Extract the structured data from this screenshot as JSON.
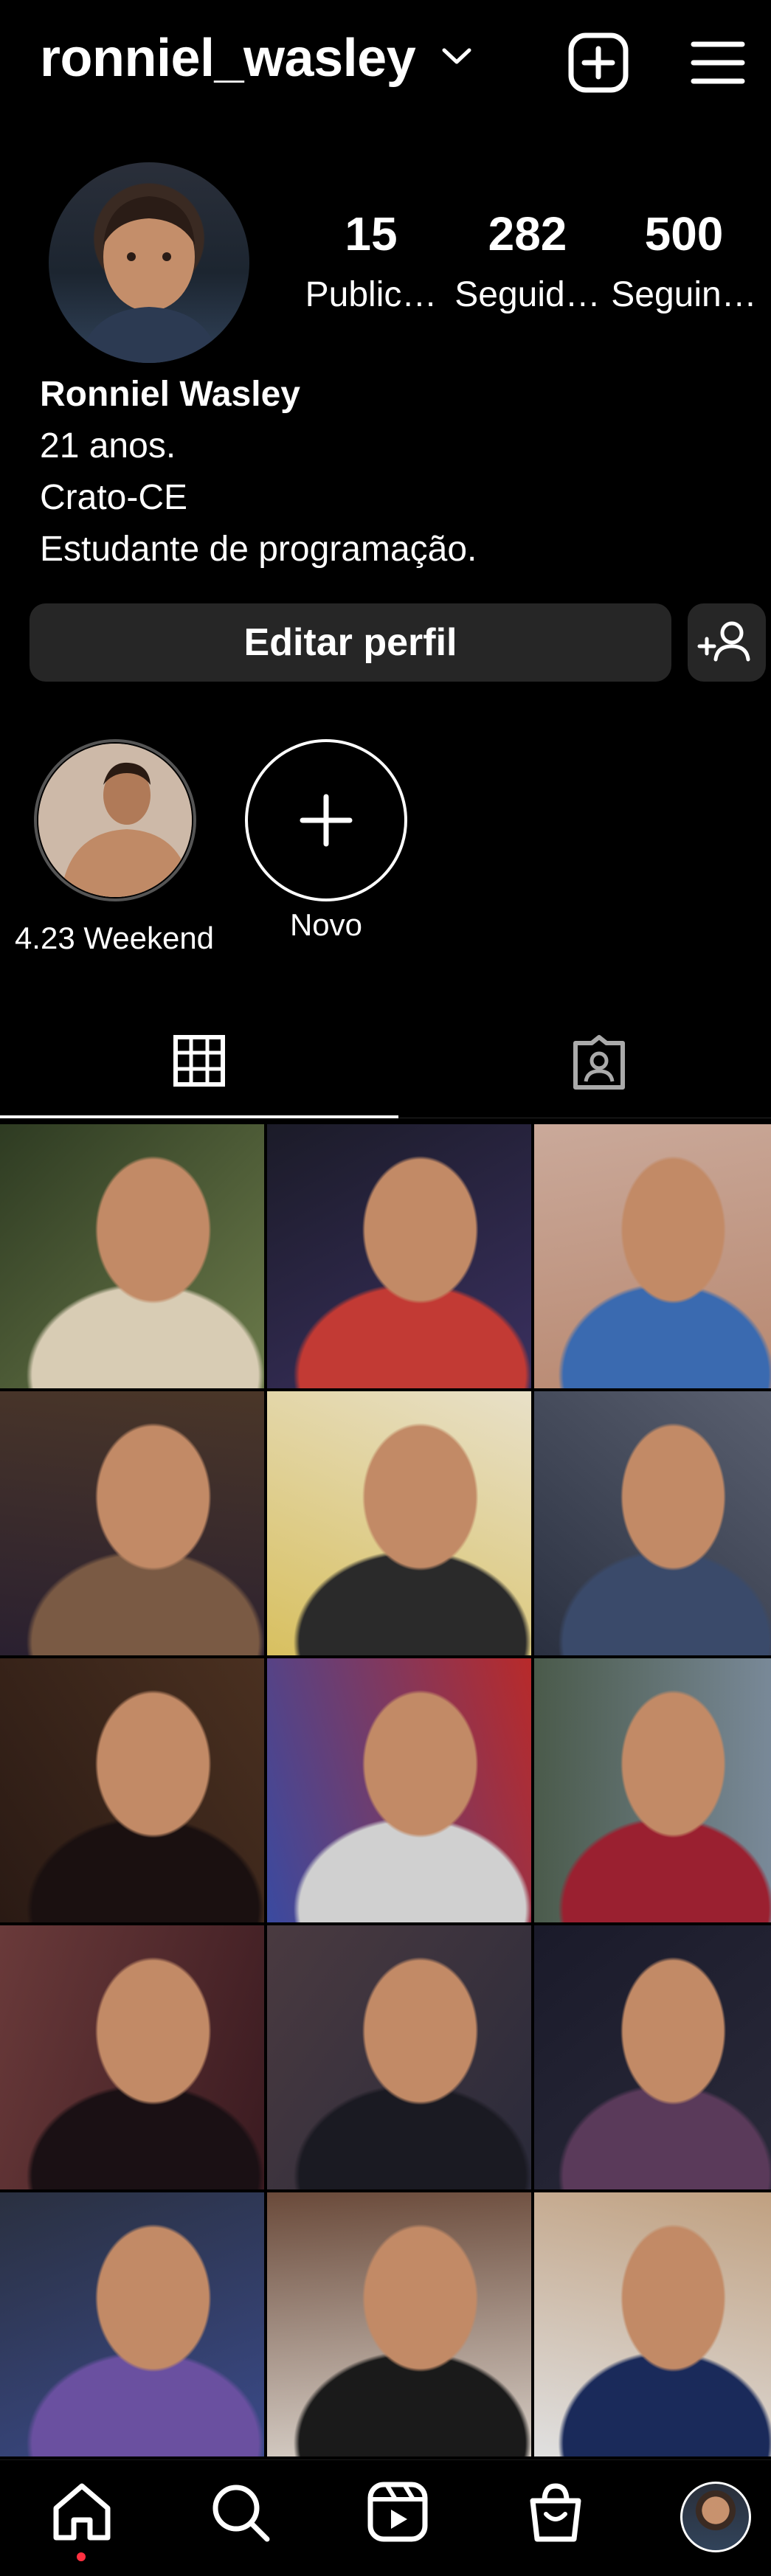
{
  "header": {
    "username": "ronniel_wasley",
    "icons": [
      "chevron-down-icon",
      "new-post-icon",
      "menu-icon"
    ]
  },
  "stats": [
    {
      "value": "15",
      "label": "Public…"
    },
    {
      "value": "282",
      "label": "Seguid…"
    },
    {
      "value": "500",
      "label": "Seguin…"
    }
  ],
  "bio": {
    "name": "Ronniel Wasley",
    "line1": "21 anos.",
    "line2": "Crato-CE",
    "line3": "Estudante de programação."
  },
  "actions": {
    "edit_profile": "Editar perfil",
    "add_person_icon": "add-person-icon"
  },
  "highlights": [
    {
      "label": "4.23 Weekend"
    },
    {
      "label": "Novo"
    }
  ],
  "tabs": [
    {
      "icon": "grid-icon",
      "active": true
    },
    {
      "icon": "tagged-icon",
      "active": false
    }
  ],
  "grid_tiles": [
    {
      "colors": [
        "#2e3b22",
        "#6b7a4a",
        "#d8ccb4"
      ]
    },
    {
      "colors": [
        "#1b1b28",
        "#3a3060",
        "#c23a34"
      ]
    },
    {
      "colors": [
        "#caa99a",
        "#b88870",
        "#3a6ab0"
      ]
    },
    {
      "colors": [
        "#4a3628",
        "#2a2030",
        "#7a5a44"
      ]
    },
    {
      "colors": [
        "#e8e0c8",
        "#d8c060",
        "#2a2a2a"
      ]
    },
    {
      "colors": [
        "#5a6070",
        "#2a3040",
        "#3a4a6a"
      ]
    },
    {
      "colors": [
        "#4a3020",
        "#2a1a14",
        "#1a1010"
      ]
    },
    {
      "colors": [
        "#b82a2a",
        "#3a4aa0",
        "#d0d0d0"
      ]
    },
    {
      "colors": [
        "#7a8a9a",
        "#4a5a4a",
        "#9a2030"
      ]
    },
    {
      "colors": [
        "#3a1a20",
        "#6a3a3a",
        "#1a1014"
      ]
    },
    {
      "colors": [
        "#2a2a3a",
        "#4a3a40",
        "#1a1a22"
      ]
    },
    {
      "colors": [
        "#2a2a3a",
        "#1a1a2a",
        "#5a3a5a"
      ]
    },
    {
      "colors": [
        "#3a4a8a",
        "#2a3040",
        "#6a50a0"
      ]
    },
    {
      "colors": [
        "#d8d0c8",
        "#6a4a3a",
        "#1a1a1a"
      ]
    },
    {
      "colors": [
        "#e0e0e0",
        "#c0a080",
        "#1a2a5a"
      ]
    }
  ],
  "nav": {
    "items": [
      "home-icon",
      "search-icon",
      "reels-icon",
      "shop-icon",
      "profile-avatar"
    ]
  }
}
